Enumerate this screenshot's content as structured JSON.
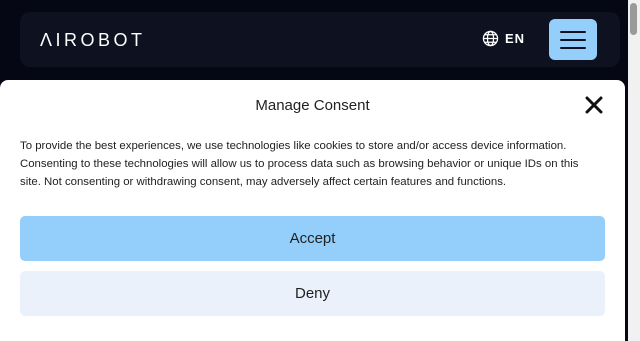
{
  "header": {
    "logo_text": "ΛIROBOT",
    "language_label": "EN"
  },
  "consent": {
    "title": "Manage Consent",
    "body": "To provide the best experiences, we use technologies like cookies to store and/or access device information. Consenting to these technologies will allow us to process data such as browsing behavior or unique IDs on this site. Not consenting or withdrawing consent, may adversely affect certain features and functions.",
    "accept_label": "Accept",
    "deny_label": "Deny"
  },
  "colors": {
    "page_background": "#050814",
    "header_background": "#0d1120",
    "accent": "#93cffa",
    "deny_background": "#ebf1fb"
  },
  "icons": {
    "language": "globe-icon",
    "menu": "hamburger-menu-icon",
    "close": "close-icon"
  }
}
